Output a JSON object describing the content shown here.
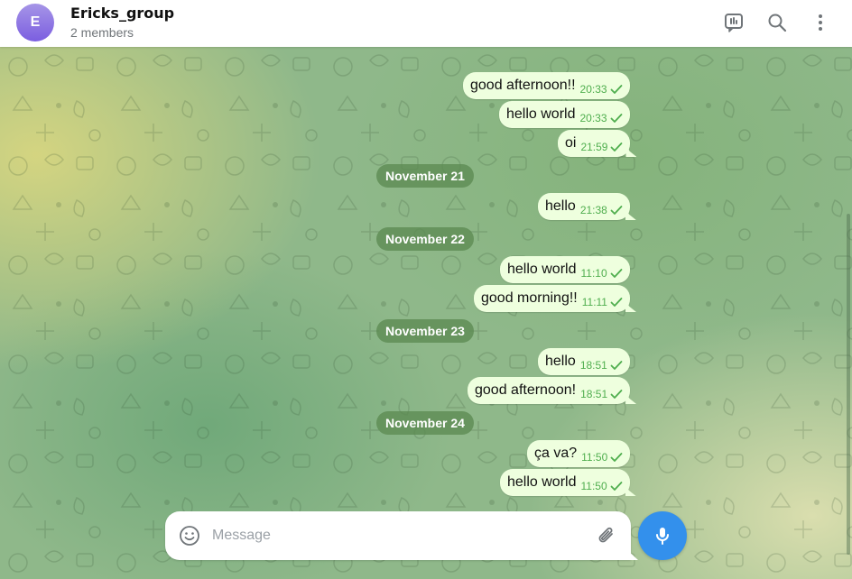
{
  "header": {
    "avatar_letter": "E",
    "title": "Ericks_group",
    "subtitle": "2 members",
    "icons": [
      "poll-icon",
      "search-icon",
      "more-vertical-icon"
    ]
  },
  "messages": [
    {
      "type": "msg",
      "text": "good afternoon!!",
      "time": "20:33",
      "tail": false
    },
    {
      "type": "msg",
      "text": "hello world",
      "time": "20:33",
      "tail": false
    },
    {
      "type": "msg",
      "text": "oi",
      "time": "21:59",
      "tail": true
    },
    {
      "type": "date",
      "text": "November 21"
    },
    {
      "type": "msg",
      "text": "hello",
      "time": "21:38",
      "tail": true
    },
    {
      "type": "date",
      "text": "November 22"
    },
    {
      "type": "msg",
      "text": "hello world",
      "time": "11:10",
      "tail": false
    },
    {
      "type": "msg",
      "text": "good morning!!",
      "time": "11:11",
      "tail": true
    },
    {
      "type": "date",
      "text": "November 23"
    },
    {
      "type": "msg",
      "text": "hello",
      "time": "18:51",
      "tail": false
    },
    {
      "type": "msg",
      "text": "good afternoon!",
      "time": "18:51",
      "tail": true
    },
    {
      "type": "date",
      "text": "November 24"
    },
    {
      "type": "msg",
      "text": "ça va?",
      "time": "11:50",
      "tail": false
    },
    {
      "type": "msg",
      "text": "hello world",
      "time": "11:50",
      "tail": true
    }
  ],
  "composer": {
    "placeholder": "Message",
    "value": ""
  },
  "colors": {
    "bubble": "#eeffde",
    "check": "#4fae4e",
    "accent": "#3390ec"
  }
}
